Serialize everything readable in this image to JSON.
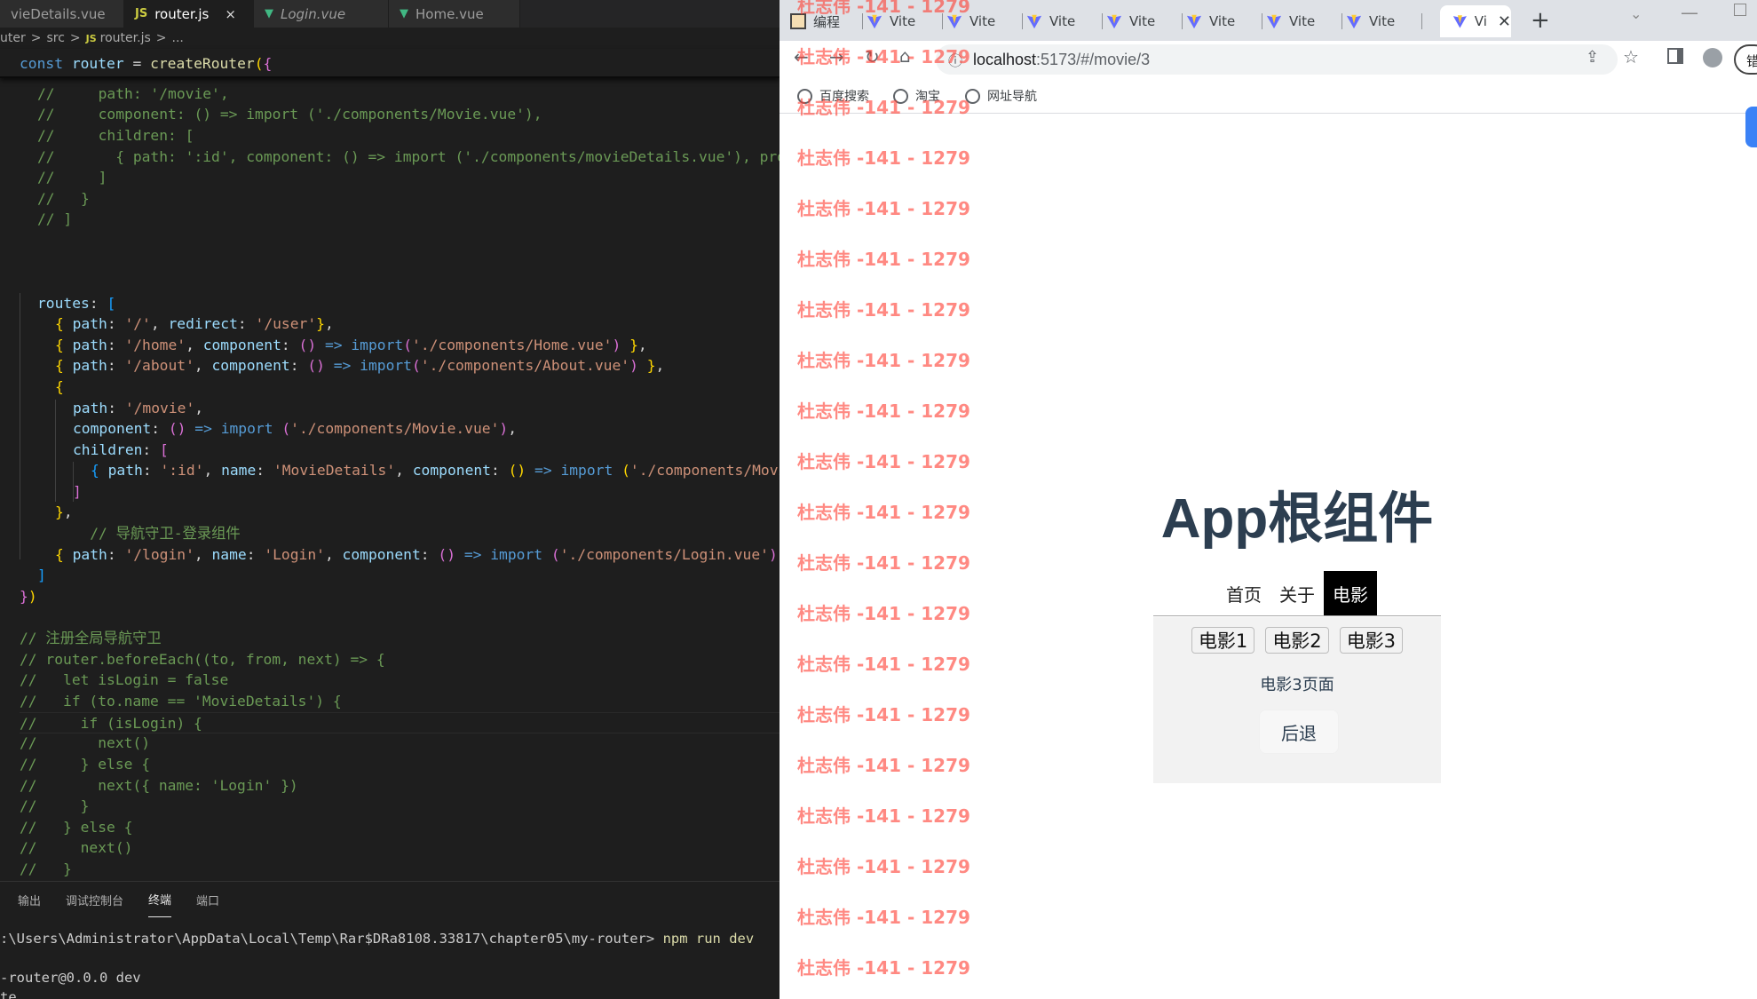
{
  "editor": {
    "tabs": [
      {
        "name": "vieDetails.vue",
        "type": "vue"
      },
      {
        "name": "router.js",
        "type": "js",
        "active": true
      },
      {
        "name": "Login.vue",
        "type": "vue",
        "italic": true
      },
      {
        "name": "Home.vue",
        "type": "vue"
      }
    ],
    "tab_close": "×",
    "breadcrumb": [
      "uter",
      ">",
      "src",
      ">",
      "JS",
      "router.js",
      ">",
      "..."
    ],
    "sticky_line": "const router = createRouter({",
    "code": [
      "//     path: '/movie',",
      "//     component: () => import ('./components/Movie.vue'),",
      "//     children: [",
      "//       { path: ':id', component: () => import ('./components/movieDetails.vue'), prop",
      "//     ]",
      "//   }",
      "// ]",
      "",
      "",
      "",
      "  routes: [",
      "    { path: '/', redirect: '/user'},",
      "    { path: '/home', component: () => import('./components/Home.vue') },",
      "    { path: '/about', component: () => import('./components/About.vue') },",
      "    {",
      "      path: '/movie',",
      "      component: () => import ('./components/Movie.vue'),",
      "      children: [",
      "        { path: ':id', name: 'MovieDetails', component: () => import ('./components/Movie",
      "      ]",
      "    },",
      "    // 导航守卫-登录组件",
      "    { path: '/login', name: 'Login', component: () => import ('./components/Login.vue') }",
      "  ]",
      "})",
      "",
      "// 注册全局导航守卫",
      "// router.beforeEach((to, from, next) => {",
      "//   let isLogin = false",
      "//   if (to.name == 'MovieDetails') {",
      "//     if (isLogin) {",
      "//       next()",
      "//     } else {",
      "//       next({ name: 'Login' })",
      "//     }",
      "//   } else {",
      "//     next()",
      "//   }"
    ],
    "panel_tabs": [
      "输出",
      "调试控制台",
      "终端",
      "端口"
    ],
    "panel_active": "终端",
    "terminal": {
      "prompt": ":\\Users\\Administrator\\AppData\\Local\\Temp\\Rar$DRa8108.33817\\chapter05\\my-router>",
      "command": "npm run dev",
      "output1": "-router@0.0.0 dev",
      "output2": "te"
    }
  },
  "browser": {
    "tabs": [
      {
        "title": "编程"
      },
      {
        "title": "Vite"
      },
      {
        "title": "Vite"
      },
      {
        "title": "Vite"
      },
      {
        "title": "Vite"
      },
      {
        "title": "Vite"
      },
      {
        "title": "Vite"
      },
      {
        "title": "Vite"
      },
      {
        "title": "Vi",
        "active": true
      }
    ],
    "new_tab": "+",
    "url_host": "localhost",
    "url_path": ":5173/#/movie/3",
    "bookmarks": [
      "百度搜索",
      "淘宝",
      "网址导航"
    ],
    "profile_initial": "错",
    "watermark_text": "杜志伟 -141 - 1279",
    "watermark_count": 20,
    "app": {
      "title": "App根组件",
      "nav": [
        {
          "label": "首页",
          "active": false
        },
        {
          "label": "关于",
          "active": false
        },
        {
          "label": "电影",
          "active": true
        }
      ],
      "movie_links": [
        "电影1",
        "电影2",
        "电影3"
      ],
      "movie_text": "电影3页面",
      "back_label": "后退"
    }
  },
  "colors": {
    "editor_bg": "#1e1e1e",
    "comment": "#6a9955",
    "string": "#ce9178",
    "keyword": "#569cd6",
    "watermark": "#ff3b30",
    "app_title": "#2c3e50"
  }
}
